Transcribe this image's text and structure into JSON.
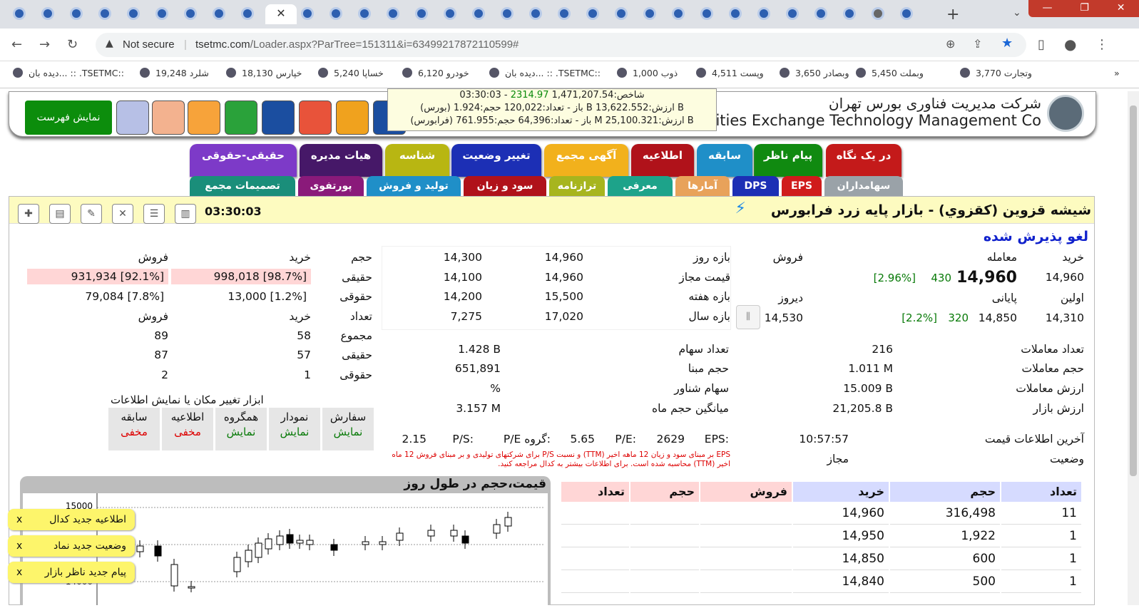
{
  "browser": {
    "url_domain": "tsetmc.com",
    "url_rest": "/Loader.aspx?ParTree=151311&i=63499217872110599#",
    "security": "Not secure",
    "bookmarks": [
      "وتجارت 3,770",
      "وبملت 5,450",
      "وبصادر 3,650",
      "وپست 4,511",
      "ذوب 1,000",
      "دیده بان... :: .TSETMC::",
      "خودرو 6,120",
      "خساپا 5,240",
      "خپارس 18,130",
      "شلرد 19,248",
      "دیده بان... :: .TSETMC::"
    ],
    "bookmarks_more": "»"
  },
  "header": {
    "company_fa": "شرکت مدیریت فناوری بورس تهران",
    "company_en": "Securities Exchange Technology Management Co",
    "menu_button": "نمایش فهرست"
  },
  "index_tooltip": {
    "line1_prefix": "شاخص:1,471,207.54 ",
    "line1_change": "2314.97",
    "line1_time": " - 03:30:03",
    "line2": "(بورس) باز - تعداد:120,022 حجم:1.924 B ارزش:13,622.552 B",
    "line3": "(فرابورس) باز - تعداد:64,396 حجم:761.955 M ارزش:25,100.321 B"
  },
  "main_tabs": [
    "در یک نگاه",
    "پیام ناظر",
    "سابقه",
    "اطلاعیه",
    "آگهی مجمع",
    "تغییر وضعیت",
    "شناسه",
    "هیات مدیره",
    "حقیقی-حقوقی"
  ],
  "sub_tabs": [
    "سهامداران",
    "EPS",
    "DPS",
    "آمارها",
    "معرفی",
    "ترازنامه",
    "سود و زیان",
    "تولید و فروش",
    "پورتفوی",
    "تصمیمات مجمع"
  ],
  "symbol": {
    "title": "شیشه قزوین (کقزوي) - بازار پایه زرد فرابورس",
    "clock": "03:30:03",
    "status_heading": "لغو پذیرش شده"
  },
  "price_box": {
    "buy_label": "خرید",
    "trade_label": "معامله",
    "sell_label": "فروش",
    "buy_value": "14,960",
    "last_trade": "14,960",
    "last_change": "430",
    "last_pct": "[2.96%]",
    "first_label": "اولین",
    "final_label": "پایانی",
    "yesterday_label": "دیروز",
    "first_value": "14,310",
    "final_value": "14,850",
    "final_change": "320",
    "final_pct": "[2.2%]",
    "yesterday_value": "14,530"
  },
  "range_box": {
    "rows": [
      {
        "label": "بازه روز",
        "a": "14,960",
        "b": "14,300"
      },
      {
        "label": "قیمت مجاز",
        "a": "14,960",
        "b": "14,100"
      },
      {
        "label": "بازه هفته",
        "a": "15,500",
        "b": "14,200"
      },
      {
        "label": "بازه سال",
        "a": "17,020",
        "b": "7,275"
      }
    ]
  },
  "legal_box": {
    "head_volume": "حجم",
    "head_buy": "خرید",
    "head_sell": "فروش",
    "real_label": "حقیقی",
    "real_buy": "998,018 [98.7%]",
    "real_sell": "931,934 [92.1%]",
    "legal_label": "حقوقی",
    "legal_buy": "13,000 [1.2%]",
    "legal_sell": "79,084 [7.8%]",
    "count_label": "تعداد",
    "total_label": "مجموع",
    "total_buy": "58",
    "total_sell": "89",
    "real2_buy": "57",
    "real2_sell": "87",
    "legal2_buy": "1",
    "legal2_sell": "2"
  },
  "stats_left": [
    {
      "label": "تعداد معاملات",
      "value": "216"
    },
    {
      "label": "حجم معاملات",
      "value": "1.011 M"
    },
    {
      "label": "ارزش معاملات",
      "value": "15.009 B"
    },
    {
      "label": "ارزش بازار",
      "value": "21,205.8 B"
    }
  ],
  "stats_mid": [
    {
      "label": "تعداد سهام",
      "value": "1.428 B"
    },
    {
      "label": "حجم مبنا",
      "value": "651,891"
    },
    {
      "label": "سهام شناور",
      "value": "%"
    },
    {
      "label": "میانگین حجم ماه",
      "value": "3.157 M"
    }
  ],
  "last_info": {
    "label": "آخرین اطلاعات قیمت",
    "value": "10:57:57",
    "status_label": "وضعیت",
    "status_value": "مجاز"
  },
  "eps_line": {
    "eps_label": "EPS:",
    "eps_value": "2629",
    "pe_label": "P/E:",
    "pe_value": "5.65",
    "gpe_label": "P/E گروه:",
    "ps_label": "P/S:",
    "ps_value": "2.15"
  },
  "eps_note": "EPS بر مبنای سود و زیان 12 ماهه اخیر (TTM) و نسبت P/S برای شرکتهای تولیدی و بر مبنای فروش 12 ماه اخیر (TTM) محاسبه شده است. برای اطلاعات بیشتر به کدال مراجعه کنید.",
  "tools": {
    "label": "ابزار تغییر مکان یا نمایش اطلاعات",
    "buttons": [
      {
        "name": "سفارش",
        "state": "نمایش"
      },
      {
        "name": "نمودار",
        "state": "نمایش"
      },
      {
        "name": "همگروه",
        "state": "نمایش"
      },
      {
        "name": "اطلاعیه",
        "state": "مخفی"
      },
      {
        "name": "سابقه",
        "state": "مخفی"
      }
    ]
  },
  "chart": {
    "title": "قیمت،حجم در طول روز",
    "ytick_top": "15000",
    "ytick_bottom": "14000"
  },
  "order_table": {
    "headers": [
      "تعداد",
      "حجم",
      "خرید",
      "فروش",
      "حجم",
      "تعداد"
    ],
    "rows": [
      {
        "count": "11",
        "volume": "316,498",
        "price": "14,960"
      },
      {
        "count": "1",
        "volume": "1,922",
        "price": "14,950"
      },
      {
        "count": "1",
        "volume": "600",
        "price": "14,850"
      },
      {
        "count": "1",
        "volume": "500",
        "price": "14,840"
      }
    ]
  },
  "toasts": [
    "اطلاعیه جدید کدال",
    "وضعیت جدید نماد",
    "پیام جدید ناظر بازار"
  ],
  "toast_close": "x",
  "colors": {
    "tab_green": "#0c8d0c",
    "heading_blue": "#1122cc",
    "title_yellow": "#fdfbc0"
  }
}
